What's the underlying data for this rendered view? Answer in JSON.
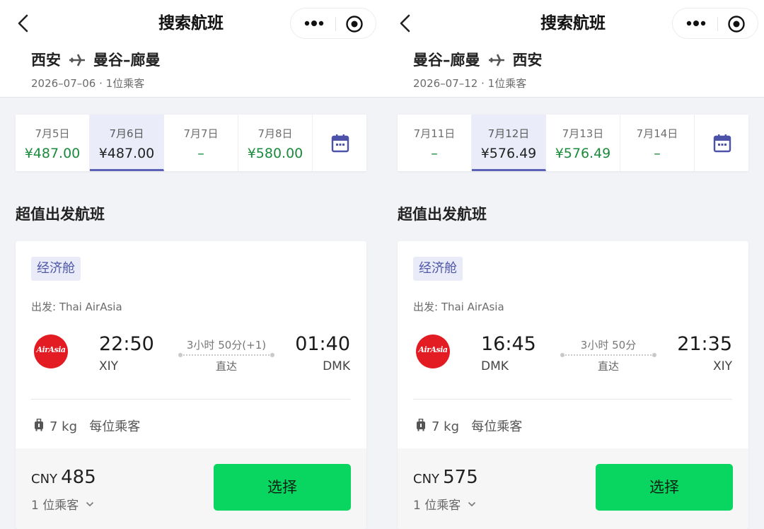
{
  "colors": {
    "price_green": "#1c8a3c",
    "select_accent": "#5b62b7",
    "button_green": "#09d660",
    "airasia_red": "#e31b23"
  },
  "panels": [
    {
      "nav": {
        "title": "搜索航班",
        "back_icon": "chevron-left-icon",
        "more_icon": "more-dots-icon",
        "close_icon": "target-icon"
      },
      "route": {
        "from": "西安",
        "to": "曼谷–廊曼",
        "icon": "airplane-icon"
      },
      "subinfo": "2026–07–06 · 1位乘客",
      "dates": [
        {
          "date": "7月5日",
          "price": "¥487.00",
          "selected": false
        },
        {
          "date": "7月6日",
          "price": "¥487.00",
          "selected": true
        },
        {
          "date": "7月7日",
          "price": "–",
          "selected": false
        },
        {
          "date": "7月8日",
          "price": "¥580.00",
          "selected": false
        }
      ],
      "section_title": "超值出发航班",
      "card": {
        "cabin": "经济舱",
        "airline": "出发: Thai AirAsia",
        "logo_text": "AirAsia",
        "dep_time": "22:50",
        "dep_code": "XIY",
        "duration": "3小时 50分(+1)",
        "direct": "直达",
        "arr_time": "01:40",
        "arr_code": "DMK",
        "baggage": "7 kg   每位乘客",
        "currency": "CNY",
        "price": "485",
        "pax": "1 位乘客",
        "button": "选择"
      }
    },
    {
      "nav": {
        "title": "搜索航班",
        "back_icon": "chevron-left-icon",
        "more_icon": "more-dots-icon",
        "close_icon": "target-icon"
      },
      "route": {
        "from": "曼谷–廊曼",
        "to": "西安",
        "icon": "airplane-icon"
      },
      "subinfo": "2026–07–12 · 1位乘客",
      "dates": [
        {
          "date": "7月11日",
          "price": "–",
          "selected": false
        },
        {
          "date": "7月12日",
          "price": "¥576.49",
          "selected": true
        },
        {
          "date": "7月13日",
          "price": "¥576.49",
          "selected": false
        },
        {
          "date": "7月14日",
          "price": "–",
          "selected": false
        }
      ],
      "section_title": "超值出发航班",
      "card": {
        "cabin": "经济舱",
        "airline": "出发: Thai AirAsia",
        "logo_text": "AirAsia",
        "dep_time": "16:45",
        "dep_code": "DMK",
        "duration": "3小时 50分",
        "direct": "直达",
        "arr_time": "21:35",
        "arr_code": "XIY",
        "baggage": "7 kg   每位乘客",
        "currency": "CNY",
        "price": "575",
        "pax": "1 位乘客",
        "button": "选择"
      }
    }
  ]
}
